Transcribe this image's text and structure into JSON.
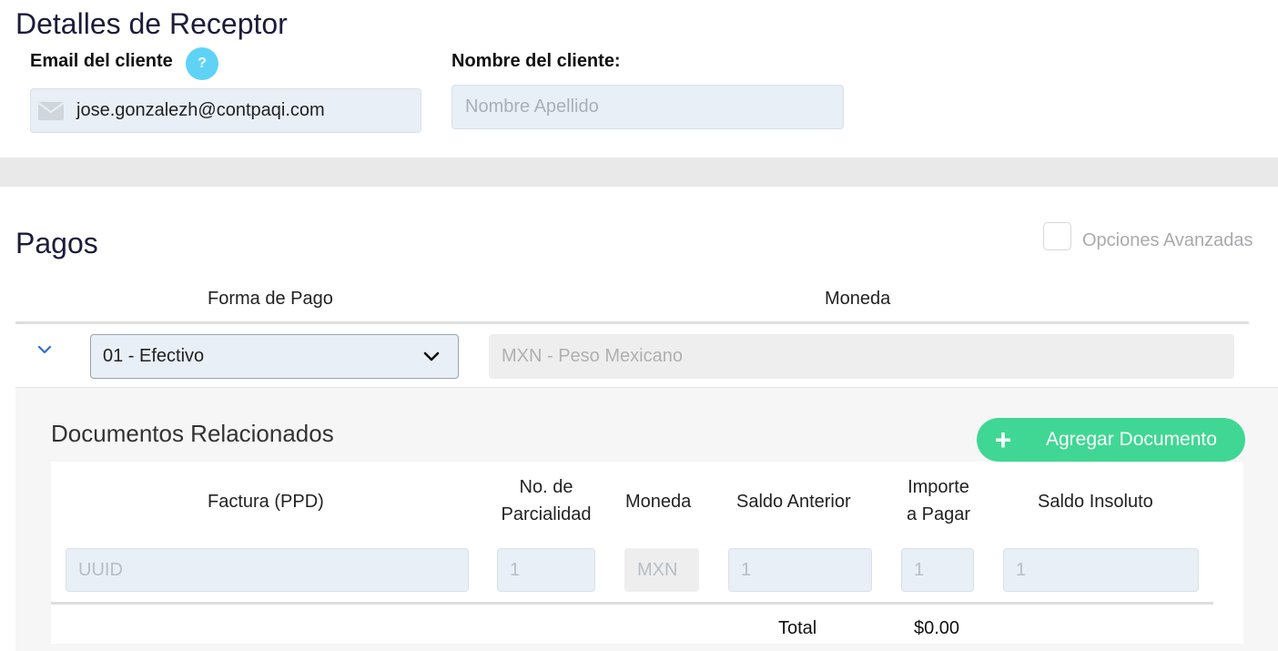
{
  "receptor": {
    "title": "Detalles de Receptor",
    "email_label": "Email del cliente",
    "help_icon": "?",
    "email_value": "jose.gonzalezh@contpaqi.com",
    "name_label": "Nombre del cliente:",
    "name_placeholder": "Nombre Apellido"
  },
  "pagos": {
    "title": "Pagos",
    "advanced_options_label": "Opciones Avanzadas",
    "advanced_options_checked": false,
    "headers": {
      "forma_pago": "Forma de Pago",
      "moneda": "Moneda"
    },
    "forma_pago_value": "01 - Efectivo",
    "moneda_value": "MXN - Peso Mexicano"
  },
  "documentos": {
    "title": "Documentos Relacionados",
    "add_button_label": "Agregar Documento",
    "columns": {
      "factura": "Factura (PPD)",
      "parcialidad_1": "No. de",
      "parcialidad_2": "Parcialidad",
      "moneda": "Moneda",
      "saldo_anterior": "Saldo Anterior",
      "importe_1": "Importe",
      "importe_2": "a Pagar",
      "saldo_insoluto": "Saldo Insoluto"
    },
    "row": {
      "uuid_placeholder": "UUID",
      "parcialidad": "1",
      "moneda": "MXN",
      "saldo_anterior": "1",
      "importe": "1",
      "saldo_insoluto": "1"
    },
    "total_label": "Total",
    "total_value": "$0.00"
  },
  "colors": {
    "accent_green": "#3fd793",
    "help_blue": "#5ed3f6",
    "chevron_blue": "#2f6fc9",
    "input_bg": "#e9eff6"
  }
}
